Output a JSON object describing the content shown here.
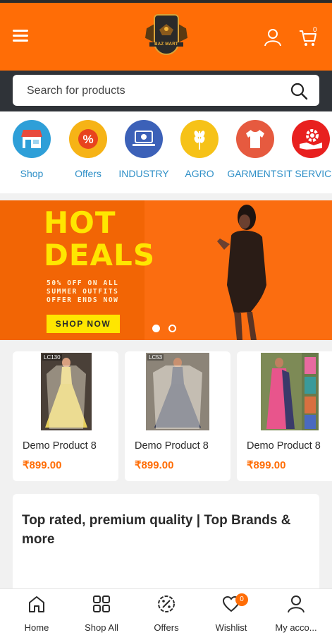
{
  "header": {
    "logo_text": "BAZ MART",
    "cart_count": "0",
    "colors": {
      "accent": "#ff6d06",
      "search_band": "#2f3338"
    }
  },
  "search": {
    "placeholder": "Search for products"
  },
  "categories": [
    {
      "label": "Shop",
      "icon": "shop-icon",
      "color": "#2e9fd8"
    },
    {
      "label": "Offers",
      "icon": "percent-icon",
      "color": "#f6b316"
    },
    {
      "label": "INDUSTRY",
      "icon": "laptop-icon",
      "color": "#3c61b8"
    },
    {
      "label": "AGRO",
      "icon": "wheat-icon",
      "color": "#f6c218"
    },
    {
      "label": "GARMENTS",
      "icon": "tshirt-icon",
      "color": "#e65a3f"
    },
    {
      "label": "IT SERVICE",
      "icon": "gear-hand-icon",
      "color": "#e8201f"
    }
  ],
  "banner": {
    "line1": "HOT",
    "line2": "DEALS",
    "sub1": "50% OFF ON ALL",
    "sub2": "SUMMER OUTFITS",
    "sub3": "OFFER ENDS NOW",
    "button": "SHOP NOW",
    "slide_index": 1,
    "slide_count": 2
  },
  "products": [
    {
      "tag": "LC130",
      "name": "Demo Product 8",
      "price": "₹899.00"
    },
    {
      "tag": "LC53",
      "name": "Demo Product 8",
      "price": "₹899.00"
    },
    {
      "tag": "",
      "name": "Demo Product 8",
      "price": "₹899.00"
    }
  ],
  "promo": {
    "title": "Top rated, premium quality | Top Brands & more"
  },
  "bottom_nav": [
    {
      "label": "Home",
      "icon": "home-icon"
    },
    {
      "label": "Shop All",
      "icon": "grid-icon"
    },
    {
      "label": "Offers",
      "icon": "percent-badge-icon"
    },
    {
      "label": "Wishlist",
      "icon": "heart-icon",
      "badge": "0"
    },
    {
      "label": "My acco...",
      "icon": "account-icon"
    }
  ]
}
